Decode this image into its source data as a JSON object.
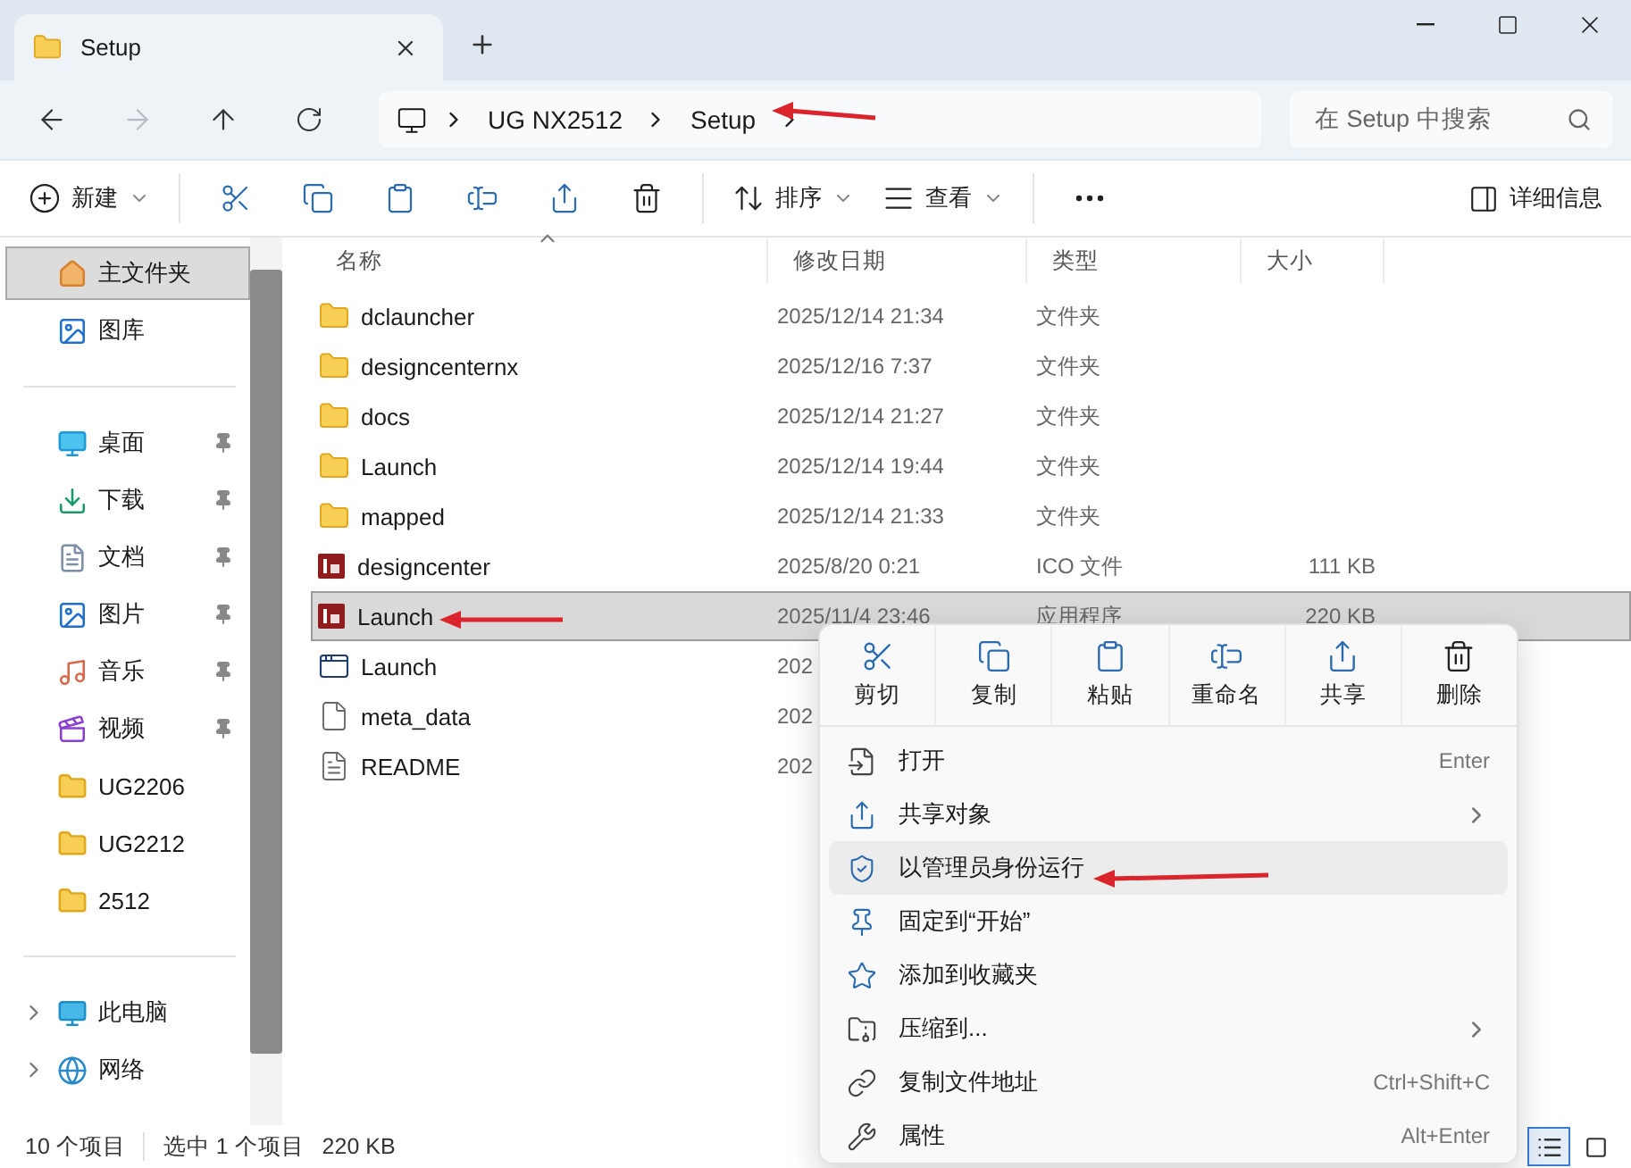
{
  "window": {
    "tab_title": "Setup"
  },
  "address": {
    "crumbs": [
      "UG NX2512",
      "Setup"
    ],
    "search_placeholder": "在 Setup 中搜索"
  },
  "toolbar": {
    "items": [
      {
        "kind": "new",
        "label": "新建",
        "dropdown": true
      },
      {
        "kind": "cut"
      },
      {
        "kind": "copy"
      },
      {
        "kind": "paste"
      },
      {
        "kind": "rename"
      },
      {
        "kind": "share"
      },
      {
        "kind": "delete"
      },
      {
        "kind": "sort",
        "label": "排序",
        "dropdown": true
      },
      {
        "kind": "view",
        "label": "查看",
        "dropdown": true
      },
      {
        "kind": "more"
      }
    ],
    "details_label": "详细信息"
  },
  "sidebar": {
    "items": [
      {
        "kind": "home",
        "label": "主文件夹",
        "selected": true
      },
      {
        "kind": "gallery",
        "label": "图库",
        "selected": false
      },
      {
        "kind": "divider"
      },
      {
        "kind": "desktop",
        "label": "桌面",
        "selected": false,
        "pinned": true
      },
      {
        "kind": "download",
        "label": "下载",
        "selected": false,
        "pinned": true
      },
      {
        "kind": "document",
        "label": "文档",
        "selected": false,
        "pinned": true
      },
      {
        "kind": "picture",
        "label": "图片",
        "selected": false,
        "pinned": true
      },
      {
        "kind": "music",
        "label": "音乐",
        "selected": false,
        "pinned": true
      },
      {
        "kind": "video",
        "label": "视频",
        "selected": false,
        "pinned": true
      },
      {
        "kind": "folder",
        "label": "UG2206",
        "selected": false,
        "pinned": false
      },
      {
        "kind": "folder",
        "label": "UG2212",
        "selected": false,
        "pinned": false
      },
      {
        "kind": "folder",
        "label": "2512",
        "selected": false,
        "pinned": false
      },
      {
        "kind": "divider"
      },
      {
        "kind": "pc",
        "label": "此电脑",
        "selected": false,
        "expanded": false
      },
      {
        "kind": "network",
        "label": "网络",
        "selected": false,
        "expanded": false
      }
    ]
  },
  "table": {
    "columns": [
      "名称",
      "修改日期",
      "类型",
      "大小"
    ],
    "rows": [
      {
        "kind": "folder",
        "name": "dclauncher",
        "date": "2025/12/14 21:34",
        "type": "文件夹",
        "size": "",
        "selected": false
      },
      {
        "kind": "folder",
        "name": "designcenternx",
        "date": "2025/12/16 7:37",
        "type": "文件夹",
        "size": "",
        "selected": false
      },
      {
        "kind": "folder",
        "name": "docs",
        "date": "2025/12/14 21:27",
        "type": "文件夹",
        "size": "",
        "selected": false
      },
      {
        "kind": "folder",
        "name": "Launch",
        "date": "2025/12/14 19:44",
        "type": "文件夹",
        "size": "",
        "selected": false
      },
      {
        "kind": "folder",
        "name": "mapped",
        "date": "2025/12/14 21:33",
        "type": "文件夹",
        "size": "",
        "selected": false
      },
      {
        "kind": "dc",
        "name": "designcenter",
        "date": "2025/8/20 0:21",
        "type": "ICO 文件",
        "size": "111 KB",
        "selected": false
      },
      {
        "kind": "dc",
        "name": "Launch",
        "date": "2025/11/4 23:46",
        "type": "应用程序",
        "size": "220 KB",
        "selected": true
      },
      {
        "kind": "window",
        "name": "Launch",
        "date": "202",
        "type": "",
        "size": "",
        "selected": false
      },
      {
        "kind": "file",
        "name": "meta_data",
        "date": "202",
        "type": "",
        "size": "",
        "selected": false
      },
      {
        "kind": "text",
        "name": "README",
        "date": "202",
        "type": "",
        "size": "",
        "selected": false
      }
    ]
  },
  "context_menu": {
    "actions": [
      {
        "kind": "cut",
        "label": "剪切"
      },
      {
        "kind": "copy",
        "label": "复制"
      },
      {
        "kind": "paste",
        "label": "粘贴"
      },
      {
        "kind": "rename",
        "label": "重命名"
      },
      {
        "kind": "share",
        "label": "共享"
      },
      {
        "kind": "delete",
        "label": "删除"
      }
    ],
    "items": [
      {
        "kind": "open",
        "label": "打开",
        "shortcut": "Enter",
        "submenu": false,
        "selected": false
      },
      {
        "kind": "share",
        "label": "共享对象",
        "submenu": true,
        "selected": false
      },
      {
        "kind": "admin",
        "label": "以管理员身份运行",
        "submenu": false,
        "selected": true
      },
      {
        "kind": "pin",
        "label": "固定到“开始”",
        "submenu": false,
        "selected": false
      },
      {
        "kind": "star",
        "label": "添加到收藏夹",
        "submenu": false,
        "selected": false
      },
      {
        "kind": "zip",
        "label": "压缩到...",
        "submenu": true,
        "selected": false
      },
      {
        "kind": "path",
        "label": "复制文件地址",
        "shortcut": "Ctrl+Shift+C",
        "submenu": false,
        "selected": false
      },
      {
        "kind": "properties",
        "label": "属性",
        "shortcut": "Alt+Enter",
        "submenu": false,
        "selected": false
      }
    ]
  },
  "status_bar": {
    "count": "10 个项目",
    "selection": "选中 1 个项目",
    "selection_size": "220 KB",
    "views": [
      {
        "kind": "details",
        "selected": true
      },
      {
        "kind": "tiles",
        "selected": false
      }
    ]
  }
}
